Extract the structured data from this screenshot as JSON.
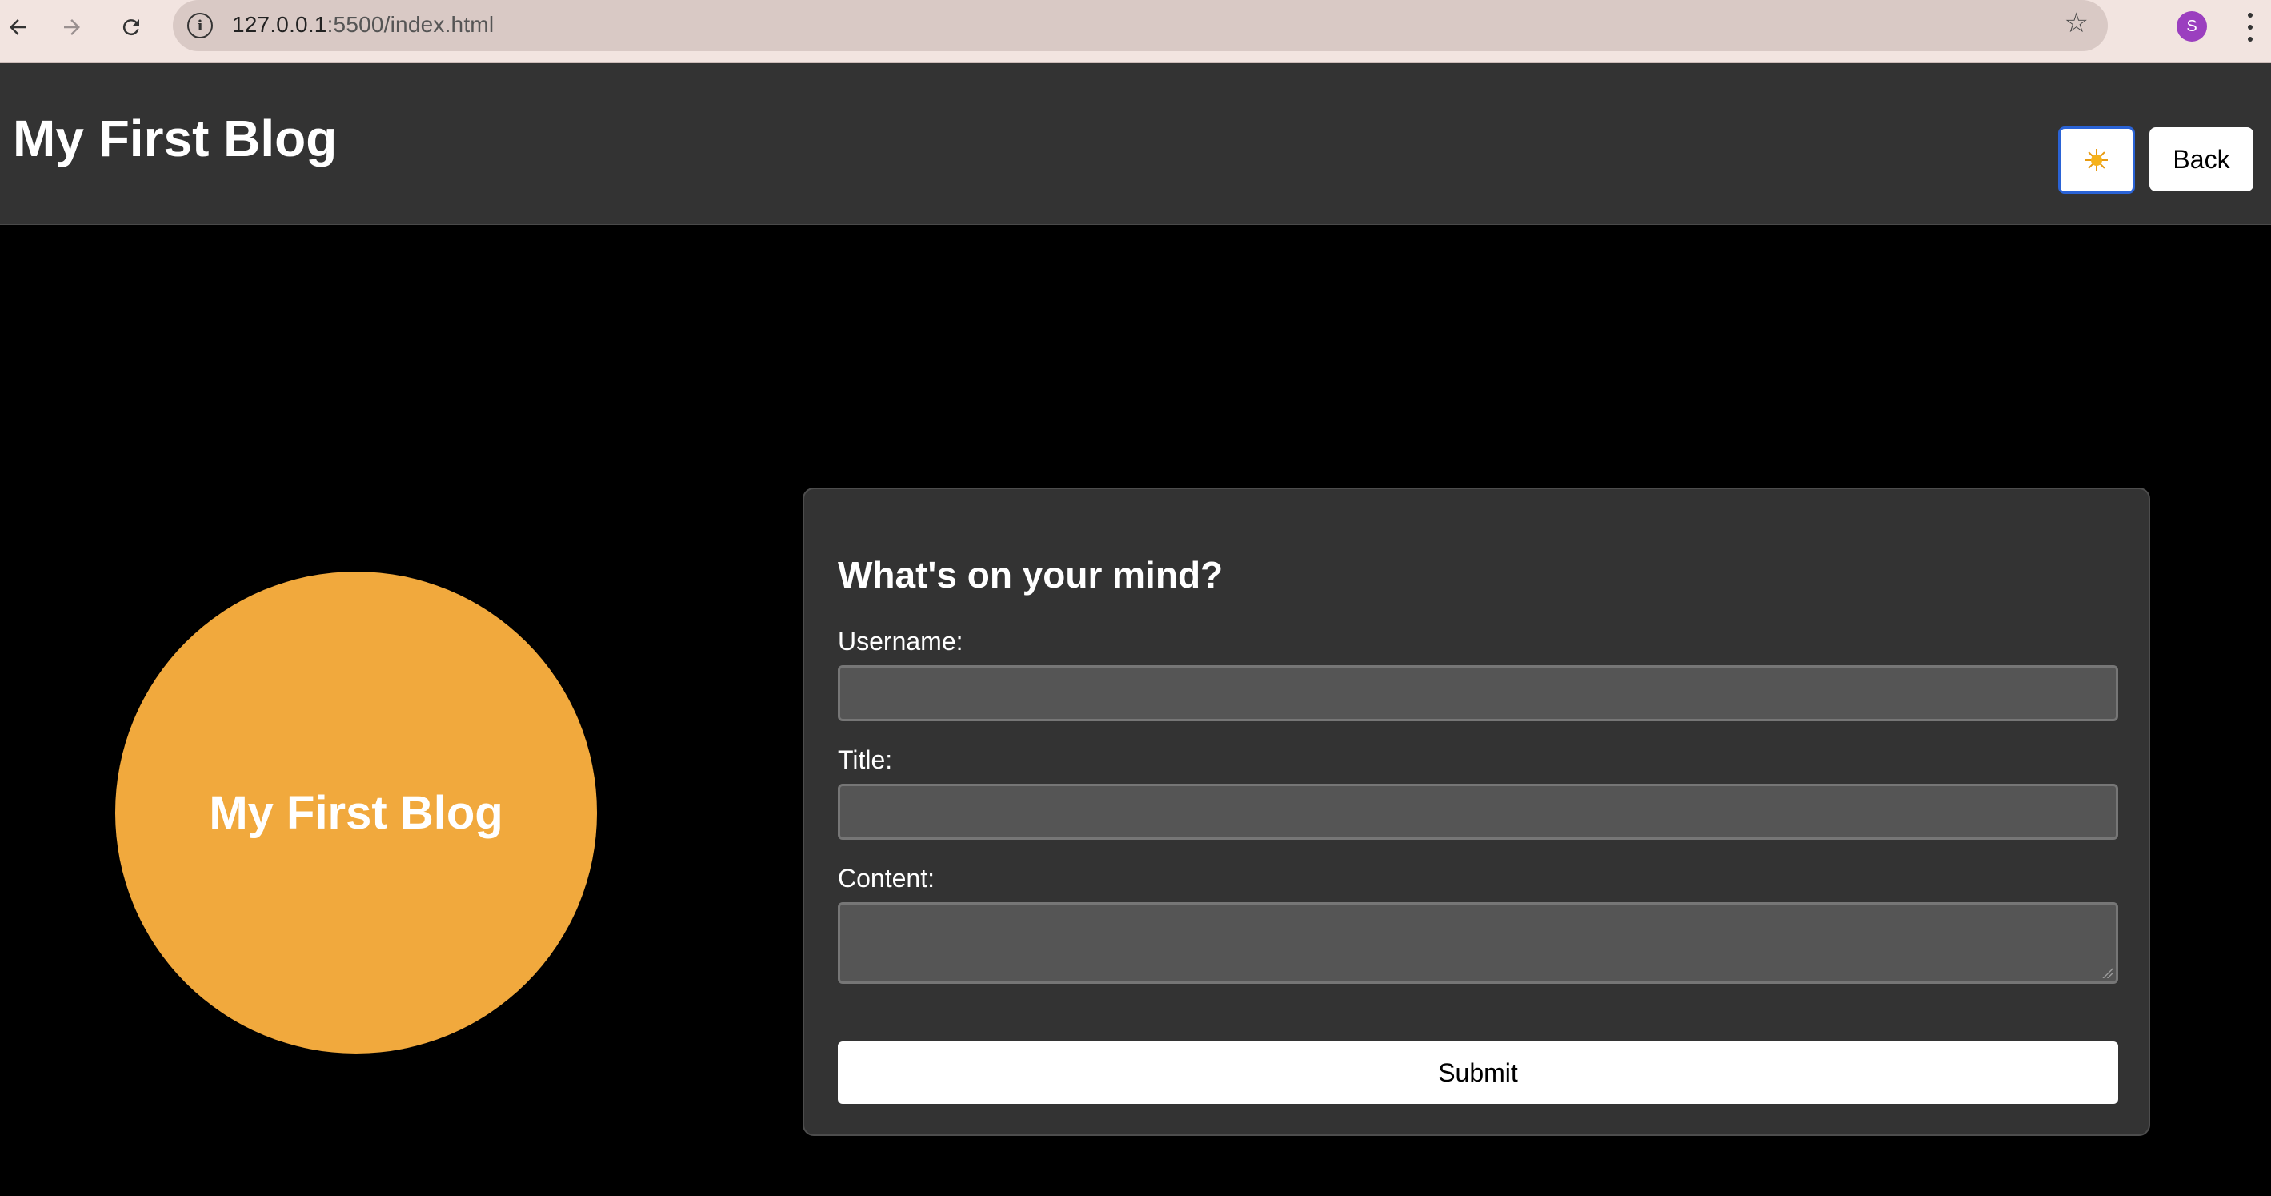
{
  "browser": {
    "url_host": "127.0.0.1",
    "url_path": ":5500/index.html",
    "profile_initial": "S"
  },
  "header": {
    "site_title": "My First Blog",
    "back_label": "Back"
  },
  "hero": {
    "circle_text": "My First Blog",
    "circle_color": "#f1a93d"
  },
  "form": {
    "heading": "What's on your mind?",
    "username_label": "Username:",
    "username_value": "",
    "title_label": "Title:",
    "title_value": "",
    "content_label": "Content:",
    "content_value": "",
    "submit_label": "Submit"
  },
  "colors": {
    "header_bg": "#333333",
    "page_bg": "#000000",
    "card_bg": "#333333",
    "input_bg": "#555555",
    "focus_ring": "#2a63d6"
  },
  "icons": {
    "back": "arrow-left-icon",
    "forward": "arrow-right-icon",
    "reload": "reload-icon",
    "site_info": "info-icon",
    "bookmark": "star-icon",
    "menu": "kebab-menu-icon",
    "theme": "sun-icon"
  }
}
